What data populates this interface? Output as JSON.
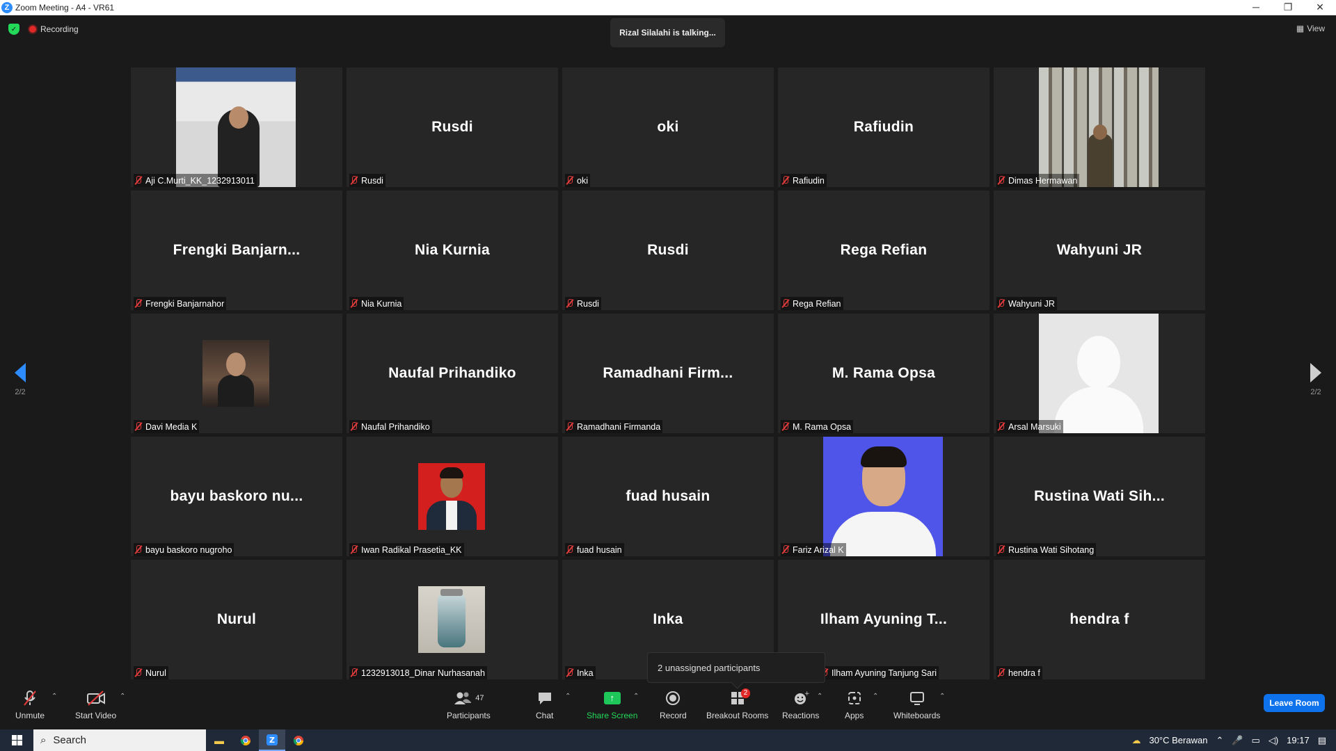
{
  "window": {
    "title": "Zoom Meeting - A4 - VR61",
    "controls": [
      "─",
      "❐",
      "✕"
    ]
  },
  "status": {
    "recording_label": "Recording",
    "talking_text": "Rizal Silalahi is talking...",
    "view_label": "View"
  },
  "pager": {
    "left_page": "2/2",
    "right_page": "2/2"
  },
  "tiles": [
    {
      "big": "",
      "label": "Aji C.Murti_KK_1232913011"
    },
    {
      "big": "Rusdi",
      "label": "Rusdi"
    },
    {
      "big": "oki",
      "label": "oki"
    },
    {
      "big": "Rafiudin",
      "label": "Rafiudin"
    },
    {
      "big": "",
      "label": "Dimas Hermawan"
    },
    {
      "big": "Frengki  Banjarn...",
      "label": "Frengki Banjarnahor"
    },
    {
      "big": "Nia Kurnia",
      "label": "Nia Kurnia"
    },
    {
      "big": "Rusdi",
      "label": "Rusdi"
    },
    {
      "big": "Rega Refian",
      "label": "Rega Refian"
    },
    {
      "big": "Wahyuni JR",
      "label": "Wahyuni JR"
    },
    {
      "big": "",
      "label": "Davi Media K"
    },
    {
      "big": "Naufal Prihandiko",
      "label": "Naufal Prihandiko"
    },
    {
      "big": "Ramadhani  Firm...",
      "label": "Ramadhani Firmanda"
    },
    {
      "big": "M. Rama Opsa",
      "label": "M. Rama Opsa"
    },
    {
      "big": "",
      "label": "Arsal Marsuki"
    },
    {
      "big": "bayu baskoro nu...",
      "label": "bayu baskoro nugroho"
    },
    {
      "big": "",
      "label": "Iwan Radikal Prasetia_KK"
    },
    {
      "big": "fuad husain",
      "label": "fuad husain"
    },
    {
      "big": "",
      "label": "Fariz Arizal K"
    },
    {
      "big": "Rustina Wati Sih...",
      "label": "Rustina Wati Sihotang"
    },
    {
      "big": "Nurul",
      "label": "Nurul"
    },
    {
      "big": "",
      "label": "1232913018_Dinar Nurhasanah"
    },
    {
      "big": "Inka",
      "label": "Inka"
    },
    {
      "big": "Ilham Ayuning T...",
      "label": "Ilham Ayuning Tanjung Sari"
    },
    {
      "big": "hendra f",
      "label": "hendra f"
    }
  ],
  "tooltip": {
    "text": "2 unassigned participants"
  },
  "toolbar": {
    "unmute": "Unmute",
    "start_video": "Start Video",
    "participants": "Participants",
    "participants_count": "47",
    "chat": "Chat",
    "share_screen": "Share Screen",
    "record": "Record",
    "breakout_rooms": "Breakout Rooms",
    "breakout_badge": "2",
    "reactions": "Reactions",
    "apps": "Apps",
    "whiteboards": "Whiteboards",
    "leave_room": "Leave Room"
  },
  "taskbar": {
    "search_label": "Search",
    "weather": "30°C  Berawan",
    "time": "19:17"
  },
  "colors": {
    "accent_blue": "#0e72ed",
    "share_green": "#1ec75a",
    "muted_red": "#e23b3b",
    "tile_bg": "#262626"
  }
}
